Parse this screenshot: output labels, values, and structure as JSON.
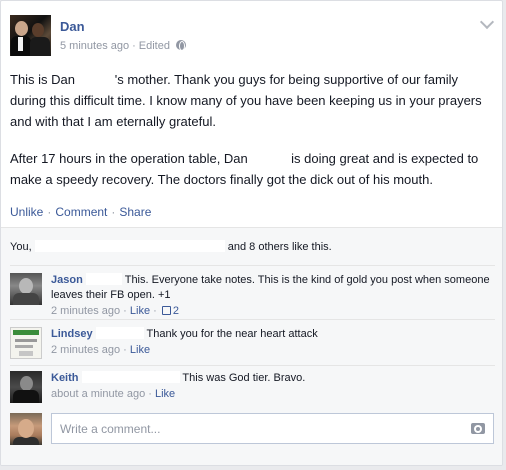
{
  "post": {
    "author": "Dan",
    "time": "5 minutes ago",
    "edited": "Edited",
    "paragraphs": [
      "This is Dan           's mother. Thank you guys for being supportive of our family during this difficult time. I know many of you have been keeping us in your prayers and with that I am eternally grateful.",
      "After 17 hours in the operation table, Dan            is doing great and is expected to make a speedy recovery. The doctors finally got the dick out of his mouth."
    ]
  },
  "actions": {
    "unlike": "Unlike",
    "comment": "Comment",
    "share": "Share"
  },
  "likes": {
    "prefix": "You,",
    "suffix": "and 8 others like this."
  },
  "comments": [
    {
      "name": "Jason",
      "text": "This. Everyone take notes. This is the kind of gold you post when someone leaves their FB open. +1",
      "time": "2 minutes ago",
      "like": "Like",
      "like_count": "2"
    },
    {
      "name": "Lindsey",
      "text": "Thank you for the near heart attack",
      "time": "2 minutes ago",
      "like": "Like"
    },
    {
      "name": "Keith",
      "text": "This was God tier. Bravo.",
      "time": "about a minute ago",
      "like": "Like"
    }
  ],
  "composer": {
    "placeholder": "Write a comment..."
  },
  "colors": {
    "link": "#3b5998",
    "meta": "#9197a3",
    "background": "#e9eaed",
    "ufi": "#f6f7f8"
  }
}
